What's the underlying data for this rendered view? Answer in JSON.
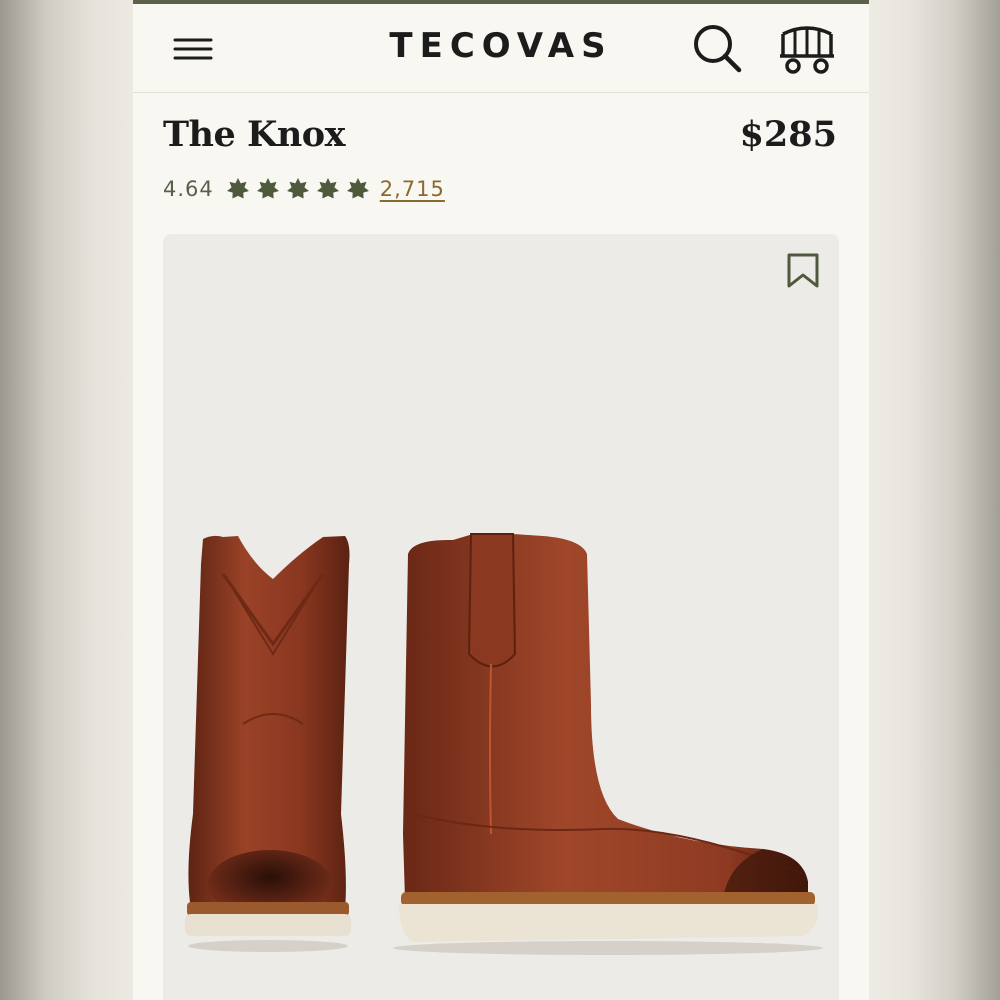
{
  "header": {
    "logo": "TECOVAS",
    "icons": {
      "menu": "hamburger-menu-icon",
      "search": "search-icon",
      "cart": "wagon-cart-icon"
    }
  },
  "product": {
    "title": "The Knox",
    "price": "$285",
    "rating": "4.64",
    "stars": 5,
    "review_count": "2,715",
    "bookmark_icon": "bookmark-icon"
  },
  "colors": {
    "brand_olive": "#5b6249",
    "review_link": "#8a6a2e",
    "background": "#f9f7f2",
    "boot_leather": "#8e3a22"
  }
}
